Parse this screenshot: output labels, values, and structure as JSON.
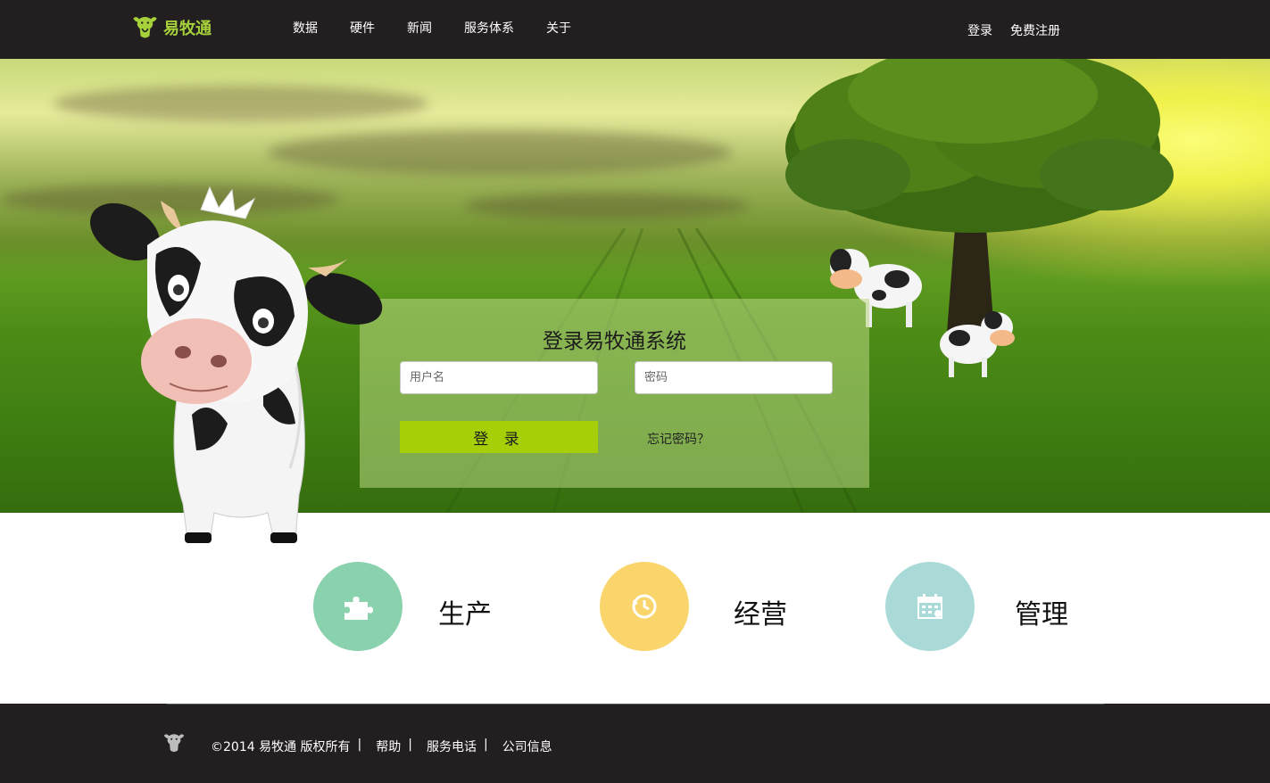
{
  "header": {
    "brand": "易牧通",
    "nav": [
      "数据",
      "硬件",
      "新闻",
      "服务体系",
      "关于"
    ],
    "login": "登录",
    "register": "免费注册"
  },
  "login": {
    "title": "登录易牧通系统",
    "username_placeholder": "用户名",
    "password_placeholder": "密码",
    "submit": "登 录",
    "forgot": "忘记密码？"
  },
  "features": [
    {
      "label": "生产",
      "icon": "puzzle-icon",
      "color": "#8ad1ad"
    },
    {
      "label": "经营",
      "icon": "history-icon",
      "color": "#f9d56c"
    },
    {
      "label": "管理",
      "icon": "calendar-icon",
      "color": "#a9dad8"
    }
  ],
  "footer": {
    "copyright": "©2014 易牧通  版权所有",
    "sep": "|",
    "help": "帮助",
    "phone": "服务电话",
    "company": "公司信息"
  },
  "colors": {
    "topbar": "#231f20",
    "brand": "#a6d13b",
    "button": "#a6cf08"
  }
}
